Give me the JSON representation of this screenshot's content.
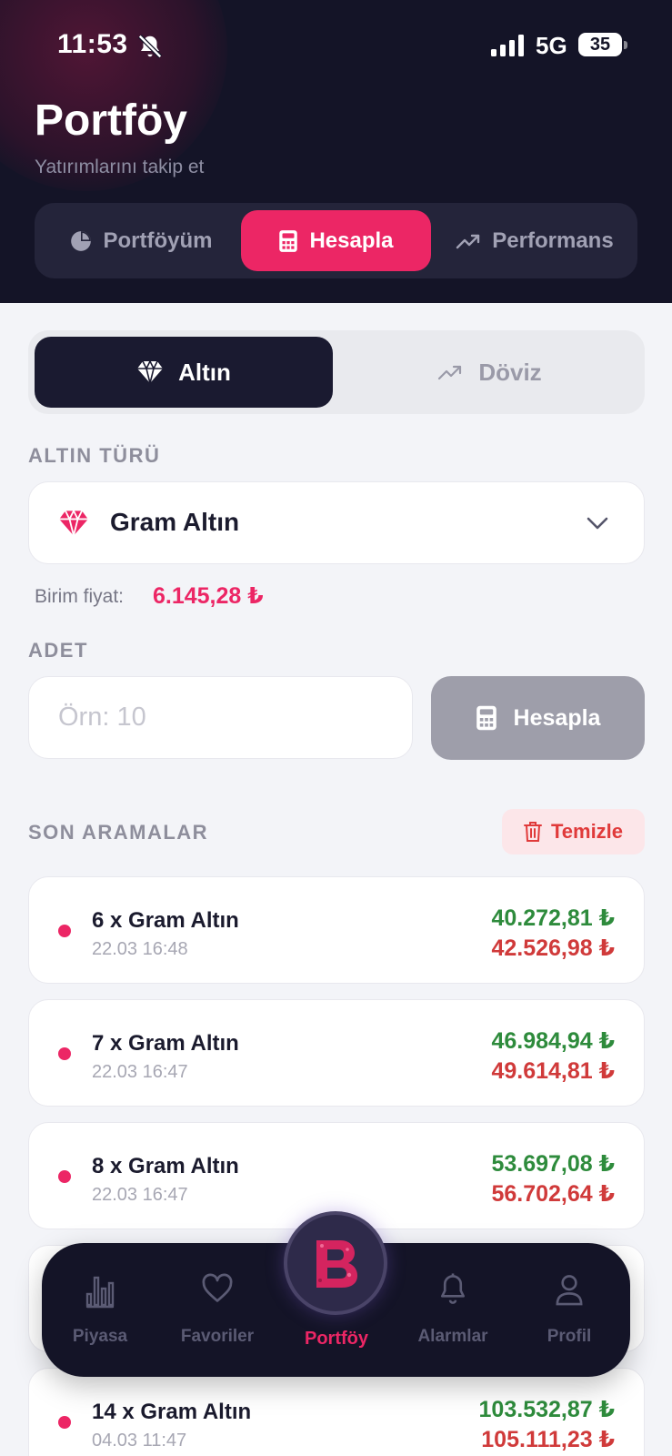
{
  "status_bar": {
    "time": "11:53",
    "network": "5G",
    "battery": "35"
  },
  "header": {
    "title": "Portföy",
    "subtitle": "Yatırımlarını takip et"
  },
  "top_tabs": [
    {
      "label": "Portföyüm",
      "icon": "pie-chart-icon",
      "active": false
    },
    {
      "label": "Hesapla",
      "icon": "calculator-icon",
      "active": true
    },
    {
      "label": "Performans",
      "icon": "trending-up-icon",
      "active": false
    }
  ],
  "segment": [
    {
      "label": "Altın",
      "icon": "diamond-icon",
      "active": true
    },
    {
      "label": "Döviz",
      "icon": "trending-up-icon",
      "active": false
    }
  ],
  "gold_type": {
    "section_label": "ALTIN TÜRÜ",
    "selected": "Gram Altın",
    "icon": "diamond-icon"
  },
  "unit_price": {
    "label": "Birim fiyat:",
    "value": "6.145,28 ₺"
  },
  "quantity": {
    "section_label": "ADET",
    "placeholder": "Örn: 10",
    "value": ""
  },
  "calculate_button": {
    "label": "Hesapla",
    "icon": "calculator-icon"
  },
  "recent": {
    "section_label": "SON ARAMALAR",
    "clear_label": "Temizle",
    "items": [
      {
        "title": "6 x Gram Altın",
        "date": "22.03 16:48",
        "buy": "40.272,81 ₺",
        "sell": "42.526,98 ₺"
      },
      {
        "title": "7 x Gram Altın",
        "date": "22.03 16:47",
        "buy": "46.984,94 ₺",
        "sell": "49.614,81 ₺"
      },
      {
        "title": "8 x Gram Altın",
        "date": "22.03 16:47",
        "buy": "53.697,08 ₺",
        "sell": "56.702,64 ₺"
      },
      {
        "title": "14 x Gram Altın",
        "date": "04.03 11:47",
        "buy": "103.532,87 ₺",
        "sell": "105.111,23 ₺"
      }
    ]
  },
  "bottom_nav": [
    {
      "label": "Piyasa",
      "icon": "bar-chart-icon"
    },
    {
      "label": "Favoriler",
      "icon": "heart-icon"
    },
    {
      "label": "Portföy",
      "icon": "brand-logo-icon",
      "active": true
    },
    {
      "label": "Alarmlar",
      "icon": "bell-icon"
    },
    {
      "label": "Profil",
      "icon": "user-icon"
    }
  ],
  "colors": {
    "accent": "#ec2665",
    "header_bg": "#141427",
    "buy": "#2e8b3c",
    "sell": "#d03a3a"
  }
}
